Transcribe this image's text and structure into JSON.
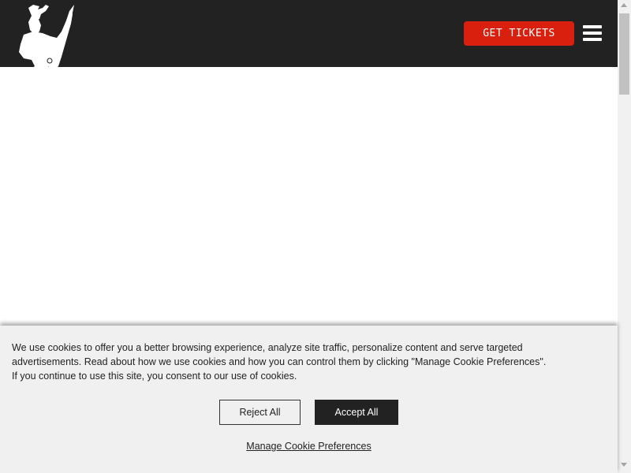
{
  "header": {
    "logo_icon": "bucking-horse-rider-logo-icon",
    "tickets_label": "GET TICKETS",
    "menu_icon": "hamburger-menu-icon"
  },
  "cookie_banner": {
    "text_line1": "We use cookies to offer you a better browsing experience, analyze site traffic, personalize content and serve targeted",
    "text_line2": "advertisements. Read about how we use cookies and how you can control them by clicking \"Manage Cookie Preferences\".",
    "text_line3": "If you continue to use this site, you consent to our use of cookies.",
    "reject_label": "Reject All",
    "accept_label": "Accept All",
    "manage_label": "Manage Cookie Preferences"
  },
  "colors": {
    "header_bg": "#222222",
    "accent_red": "#d9200f",
    "banner_bg": "#f0f0f0"
  }
}
